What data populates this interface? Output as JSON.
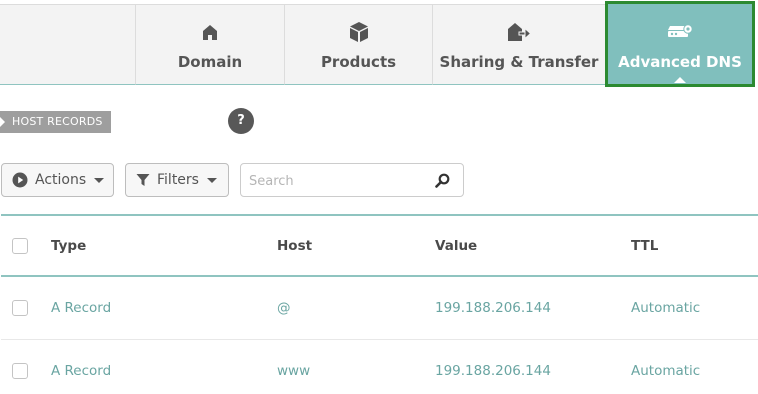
{
  "tabs": {
    "domain": {
      "label": "Domain",
      "icon": "house-icon"
    },
    "products": {
      "label": "Products",
      "icon": "box-icon"
    },
    "sharing": {
      "label": "Sharing & Transfer",
      "icon": "house-transfer-icon"
    },
    "advanced_dns": {
      "label": "Advanced DNS",
      "icon": "server-settings-icon",
      "active": true
    }
  },
  "section": {
    "badge": "HOST RECORDS",
    "help": "?"
  },
  "toolbar": {
    "actions_label": "Actions",
    "filters_label": "Filters",
    "search_placeholder": "Search"
  },
  "table": {
    "columns": [
      "Type",
      "Host",
      "Value",
      "TTL"
    ],
    "rows": [
      {
        "type": "A Record",
        "host": "@",
        "value": "199.188.206.144",
        "ttl": "Automatic"
      },
      {
        "type": "A Record",
        "host": "www",
        "value": "199.188.206.144",
        "ttl": "Automatic"
      }
    ]
  },
  "colors": {
    "accent": "#80bfbd",
    "highlight_border": "#2c8a31",
    "link_text": "#6aa5a2"
  }
}
